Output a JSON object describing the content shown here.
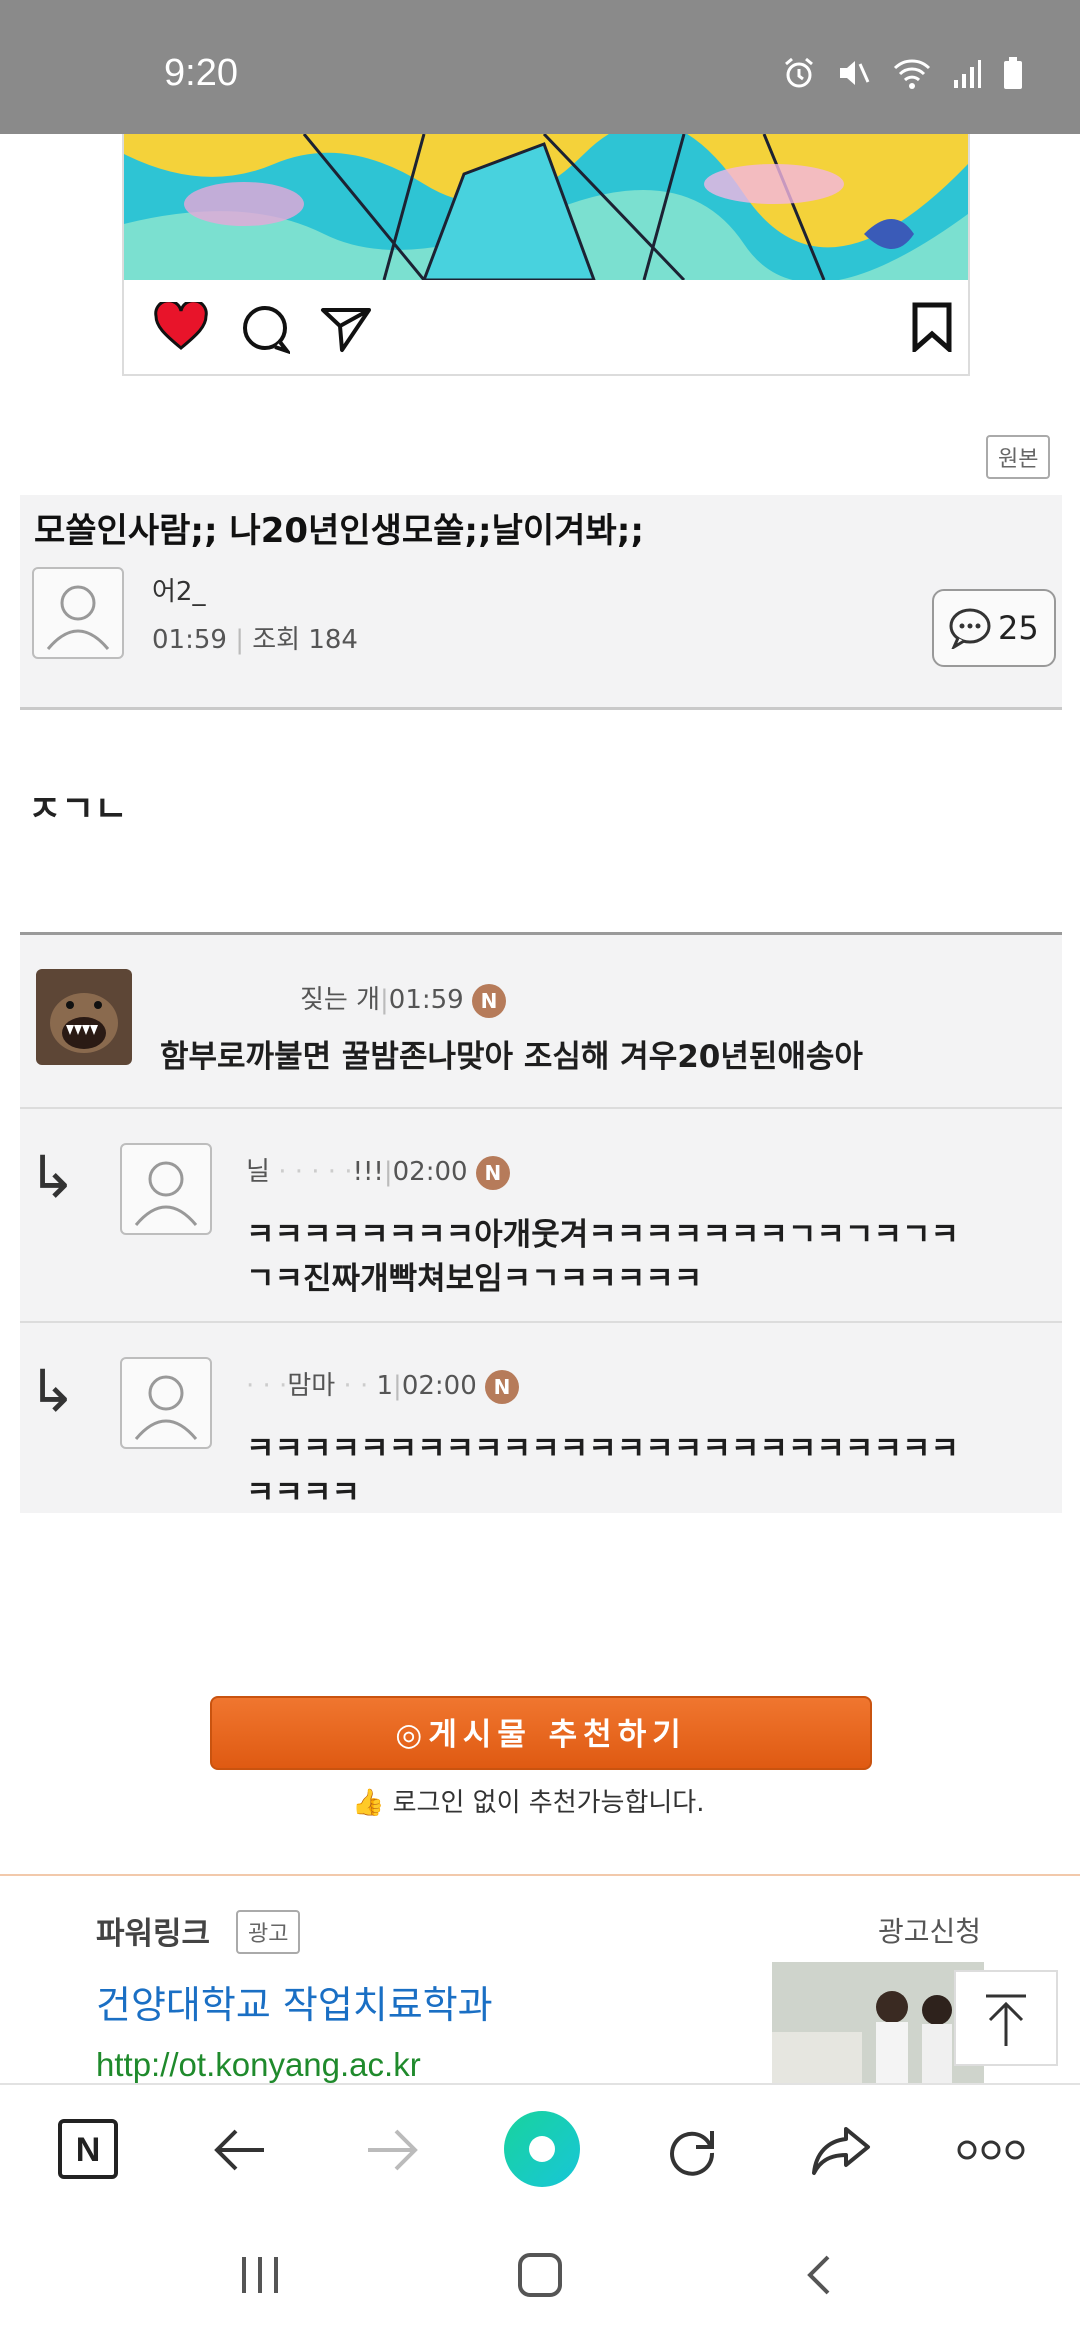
{
  "status_bar": {
    "time": "9:20"
  },
  "badge_original": "원본",
  "post": {
    "title": "모쏠인사람;; 나20년인생모쏠;;날이겨봐;;",
    "author": "어2_",
    "time": "01:59",
    "views": "조회 184",
    "comment_count": "25",
    "body": "ㅈㄱㄴ"
  },
  "comments": [
    {
      "author": "짖는 개",
      "time": "01:59",
      "badge": "N",
      "text": "함부로까불면 꿀밤존나맞아 조심해 겨우20년된애송아"
    },
    {
      "author": "닐",
      "author_suffix": "!!!",
      "time": "02:00",
      "badge": "N",
      "text_line1": "ㅋㅋㅋㅋㅋㅋㅋㅋ아개웃겨ㅋㅋㅋㅋㅋㅋㅋㄱㅋㄱㅋㄱㅋ",
      "text_line2": "ㄱㅋ진짜개빡쳐보임ㅋㄱㅋㅋㅋㅋㅋ"
    },
    {
      "author": "맘마",
      "author_suffix": "1",
      "time": "02:00",
      "badge": "N",
      "text_line1": "ㅋㅋㅋㅋㅋㅋㅋㅋㅋㅋㅋㅋㅋㅋㅋㅋㅋㅋㅋㅋㅋㅋㅋㅋㅋ",
      "text_line2": "ㅋㅋㅋㅋ"
    }
  ],
  "recommend": {
    "button_label": "게시물 추천하기",
    "note": "로그인 없이 추천가능합니다."
  },
  "powerlink": {
    "label": "파워링크",
    "ad_badge": "광고",
    "apply": "광고신청",
    "ad_title": "건양대학교 작업치료학과",
    "ad_url": "http://ot.konyang.ac.kr"
  },
  "icons": [
    "heart-icon",
    "comment-icon",
    "send-icon",
    "bookmark-icon",
    "back-icon",
    "forward-icon",
    "reload-icon",
    "share-icon",
    "more-icon",
    "scroll-top-icon",
    "recents-icon",
    "home-icon",
    "nav-back-icon"
  ],
  "colors": {
    "accent_orange": "#e8651c",
    "link_blue": "#1a6fc4",
    "url_green": "#1f8a2c",
    "status_gray": "#8a8a8a"
  }
}
